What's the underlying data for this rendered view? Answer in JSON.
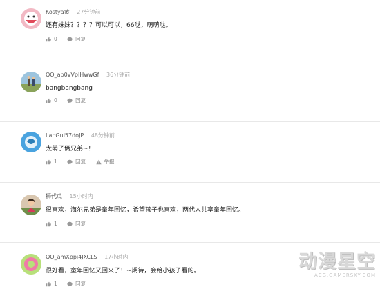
{
  "comments": [
    {
      "username": "Kostya黄",
      "time": "27分钟前",
      "text": "还有妹妹？？？？可以可以，66哒，萌萌哒。",
      "likes": "0",
      "reply": "回复",
      "report": ""
    },
    {
      "username": "QQ_ap0vVpIHwwGf",
      "time": "36分钟前",
      "text": "bangbangbang",
      "likes": "0",
      "reply": "回复",
      "report": ""
    },
    {
      "username": "LanGui57doJP",
      "time": "48分钟前",
      "text": "太萌了俩兄弟~！",
      "likes": "1",
      "reply": "回复",
      "report": "举报"
    },
    {
      "username": "狮代瓜",
      "time": "15小时内",
      "text": "很喜欢，海尔兄弟是童年回忆，希望孩子也喜欢，两代人共享童年回忆。",
      "likes": "1",
      "reply": "回复",
      "report": ""
    },
    {
      "username": "QQ_amXppi4JXCLS",
      "time": "17小时内",
      "text": "很好看，童年回忆又回来了！~期待，会给小孩子看的。",
      "likes": "1",
      "reply": "回复",
      "report": ""
    }
  ],
  "watermark": {
    "main": "动漫星空",
    "sub": "ACG.GAMERSKY.COM"
  }
}
